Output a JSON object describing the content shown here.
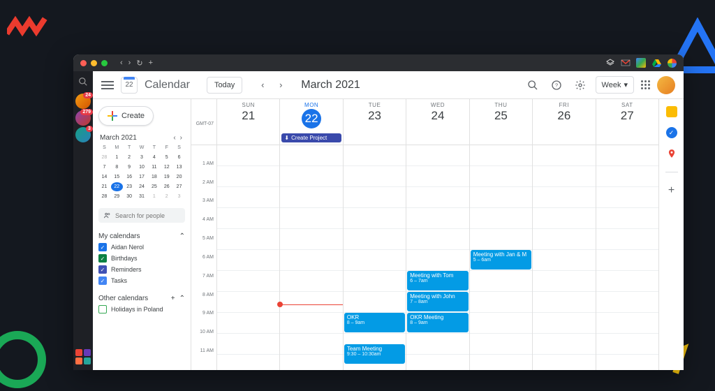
{
  "header": {
    "app_title": "Calendar",
    "logo_day": "22",
    "today_label": "Today",
    "month_title": "March 2021",
    "view_label": "Week"
  },
  "sidebar_avatars": [
    {
      "badge": "24"
    },
    {
      "badge": "279"
    },
    {
      "badge": "3"
    }
  ],
  "mini_calendar": {
    "title": "March 2021",
    "dow": [
      "S",
      "M",
      "T",
      "W",
      "T",
      "F",
      "S"
    ],
    "days": [
      {
        "n": "28",
        "m": true
      },
      {
        "n": "1"
      },
      {
        "n": "2"
      },
      {
        "n": "3"
      },
      {
        "n": "4"
      },
      {
        "n": "5"
      },
      {
        "n": "6"
      },
      {
        "n": "7"
      },
      {
        "n": "8"
      },
      {
        "n": "9"
      },
      {
        "n": "10"
      },
      {
        "n": "11"
      },
      {
        "n": "12"
      },
      {
        "n": "13"
      },
      {
        "n": "14"
      },
      {
        "n": "15"
      },
      {
        "n": "16"
      },
      {
        "n": "17"
      },
      {
        "n": "18"
      },
      {
        "n": "19"
      },
      {
        "n": "20"
      },
      {
        "n": "21"
      },
      {
        "n": "22",
        "today": true
      },
      {
        "n": "23"
      },
      {
        "n": "24"
      },
      {
        "n": "25"
      },
      {
        "n": "26"
      },
      {
        "n": "27"
      },
      {
        "n": "28"
      },
      {
        "n": "29"
      },
      {
        "n": "30"
      },
      {
        "n": "31"
      },
      {
        "n": "1",
        "m": true
      },
      {
        "n": "2",
        "m": true
      },
      {
        "n": "3",
        "m": true
      }
    ]
  },
  "create_label": "Create",
  "search_people": {
    "placeholder": "Search for people"
  },
  "my_calendars": {
    "title": "My calendars",
    "items": [
      {
        "label": "Aidan Nerol",
        "color": "#1a73e8",
        "checked": true
      },
      {
        "label": "Birthdays",
        "color": "#0b8043",
        "checked": true
      },
      {
        "label": "Reminders",
        "color": "#3f51b5",
        "checked": true
      },
      {
        "label": "Tasks",
        "color": "#4285f4",
        "checked": true
      }
    ]
  },
  "other_calendars": {
    "title": "Other calendars",
    "items": [
      {
        "label": "Holidays in Poland",
        "color": "#34a853",
        "checked": false
      }
    ]
  },
  "timezone": "GMT-07",
  "days": [
    {
      "dow": "SUN",
      "num": "21"
    },
    {
      "dow": "MON",
      "num": "22",
      "today": true
    },
    {
      "dow": "TUE",
      "num": "23"
    },
    {
      "dow": "WED",
      "num": "24"
    },
    {
      "dow": "THU",
      "num": "25"
    },
    {
      "dow": "FRI",
      "num": "26"
    },
    {
      "dow": "SAT",
      "num": "27"
    }
  ],
  "allday_event": {
    "day": 1,
    "title": "Create Project"
  },
  "hours": [
    "1 AM",
    "2 AM",
    "3 AM",
    "4 AM",
    "5 AM",
    "6 AM",
    "7 AM",
    "8 AM",
    "9 AM",
    "10 AM",
    "11 AM"
  ],
  "now_indicator": {
    "day": 1,
    "hour_offset": 7.6
  },
  "events": [
    {
      "day": 2,
      "start": 8,
      "end": 9,
      "title": "OKR",
      "time": "8 – 9am"
    },
    {
      "day": 2,
      "start": 9.5,
      "end": 10.5,
      "title": "Team Meeting",
      "time": "9:30 – 10:30am"
    },
    {
      "day": 3,
      "start": 6,
      "end": 7,
      "title": "Meeting with Tom",
      "time": "6 – 7am"
    },
    {
      "day": 3,
      "start": 7,
      "end": 8,
      "title": "Meeting with John",
      "time": "7 – 8am"
    },
    {
      "day": 3,
      "start": 8,
      "end": 9,
      "title": "OKR Meeting",
      "time": "8 – 9am"
    },
    {
      "day": 4,
      "start": 5,
      "end": 6,
      "title": "Meeting with Jan & M",
      "time": "5 – 6am"
    }
  ]
}
